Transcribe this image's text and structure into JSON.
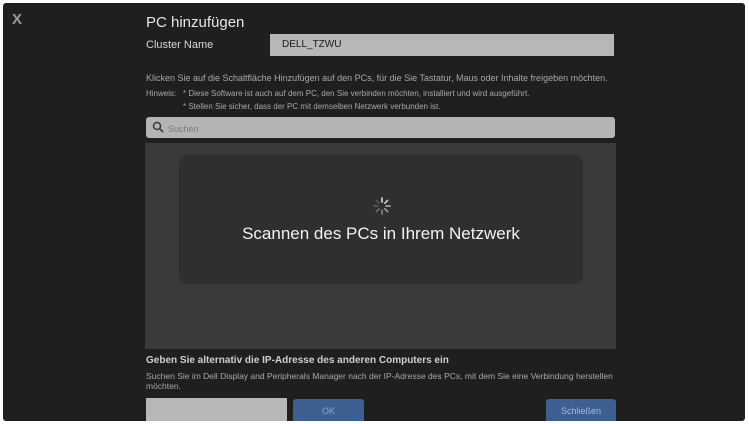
{
  "dialog": {
    "close_glyph": "X",
    "title": "PC hinzufügen",
    "cluster_label": "Cluster Name",
    "cluster_value": "DELL_TZWU",
    "instruction": "Klicken Sie auf die Schaltfläche Hinzufügen auf den PCs, für die Sie Tastatur, Maus oder Inhalte freigeben möchten.",
    "hint_label": "Hinweis:",
    "hints": [
      "* Diese Software ist auch auf dem PC, den Sie verbinden möchten, installiert und wird ausgeführt.",
      "* Stellen Sie sicher, dass der PC mit demselben Netzwerk verbunden ist."
    ]
  },
  "search": {
    "placeholder": "Suchen",
    "icon": "search-icon"
  },
  "scan": {
    "status_text": "Scannen des PCs in Ihrem Netzwerk",
    "icon": "spinner-icon"
  },
  "alternative": {
    "title": "Geben Sie alternativ die IP-Adresse des anderen Computers ein",
    "description": "Suchen Sie im Dell Display and Peripherals Manager nach der IP-Adresse des PCs, mit dem Sie eine Verbindung herstellen möchten.",
    "ip_value": "",
    "ok_label": "OK",
    "close_label": "Schließen"
  },
  "colors": {
    "background": "#1f1f1f",
    "accent_button": "#3d5f92",
    "input": "#b7b7b7"
  }
}
